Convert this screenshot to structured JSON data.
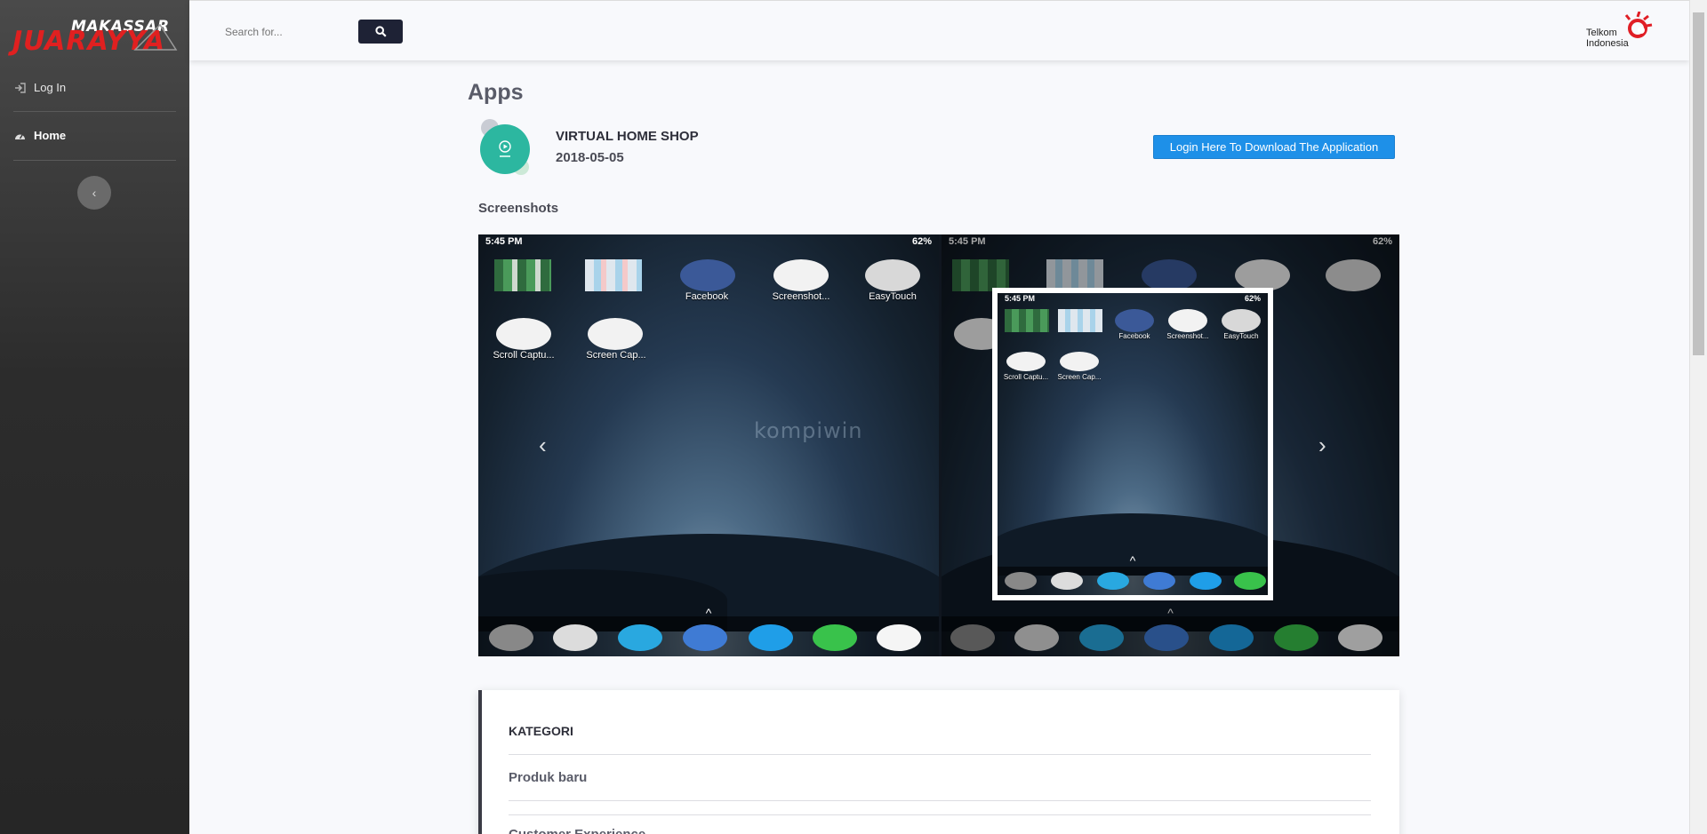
{
  "brand": {
    "top": "MAKASSAR",
    "main": "JUARAYYA"
  },
  "sidebar": {
    "items": [
      {
        "label": "Log In",
        "icon": "sign-in-icon"
      },
      {
        "label": "Home",
        "icon": "dashboard-icon"
      }
    ],
    "toggle_icon": "chevron-left-icon"
  },
  "topbar": {
    "search_placeholder": "Search for...",
    "search_icon": "search-icon",
    "partner_logo_text": [
      "Telkom",
      "Indonesia"
    ]
  },
  "page": {
    "title": "Apps"
  },
  "app": {
    "name": "VIRTUAL HOME SHOP",
    "date": "2018-05-05",
    "download_label": "Login Here To Download The Application"
  },
  "screenshots": {
    "label": "Screenshots",
    "left": {
      "time": "5:45 PM",
      "battery": "62%",
      "apps": [
        "Facebook",
        "Screenshot...",
        "EasyTouch",
        "Scroll Captu...",
        "Screen Cap..."
      ]
    },
    "right": {
      "time": "5:45 PM",
      "battery": "62%",
      "inset_time": "5:45 PM",
      "inset_battery": "62%",
      "inset_apps": [
        "Facebook",
        "Screenshot...",
        "EasyTouch",
        "Scroll Captu...",
        "Screen Cap..."
      ]
    },
    "watermark": "kompiwin"
  },
  "kategori": {
    "title": "KATEGORI",
    "items": [
      "Produk baru",
      "Customer Experience"
    ]
  },
  "colors": {
    "accent": "#1e90e8",
    "sidebar": "#2c2c2c",
    "brand_red": "#e02020",
    "search_btn": "#1e2235"
  }
}
